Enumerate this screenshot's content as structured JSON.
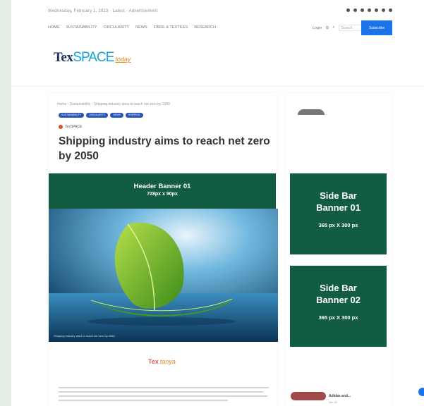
{
  "topbar": {
    "date": "Wednesday, February 1, 2023  ·  Latest  ·  Advertisement"
  },
  "nav": {
    "items": [
      "Home",
      "Sustainability",
      "Circularity",
      "News",
      "Fibre & Textiles",
      "Research"
    ],
    "right_label": "Login",
    "search_placeholder": "Search",
    "subscribe_label": "Subscribe"
  },
  "logo": {
    "part1": "Tex",
    "part2": "SPACE",
    "part3": "today"
  },
  "article": {
    "breadcrumb": "Home › Sustainability › Shipping industry aims to reach net zero by 2050",
    "tags": [
      "SUSTAINABILITY",
      "CIRCULARITY",
      "NEWS",
      "SHIPPING"
    ],
    "author": "TexSPACE",
    "title": "Shipping industry aims to reach net zero by 2050",
    "image_caption": "Shipping industry aims to reach net zero by 2050"
  },
  "header_banner": {
    "title": "Header Banner 01",
    "size": "728px x 90px"
  },
  "side_banners": [
    {
      "title_line1": "Side Bar",
      "title_line2": "Banner 01",
      "size": "365 px X 300 px"
    },
    {
      "title_line1": "Side Bar",
      "title_line2": "Banner 02",
      "size": "365 px X 300 px"
    }
  ],
  "mini_logo": {
    "part1": "Tex",
    "part2": "tanya"
  },
  "sidebar": {
    "link_title": "Adidas and...",
    "link_meta": "Jan 30"
  },
  "colors": {
    "banner_green": "#125c43",
    "accent_blue": "#1a73e8",
    "tag_blue": "#2a55b5"
  }
}
